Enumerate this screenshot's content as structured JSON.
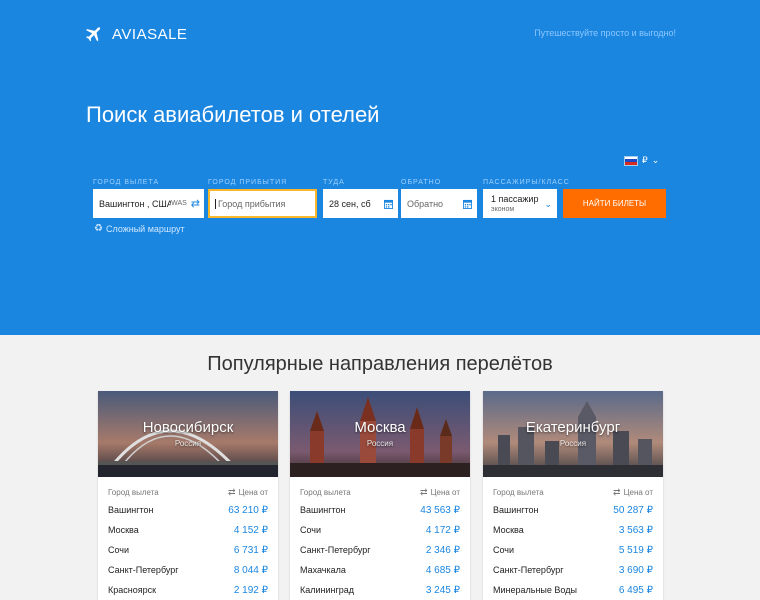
{
  "header": {
    "logo_text": "AVIASALE",
    "logo_icon": "airplane-icon",
    "slogan": "Путешествуйте просто и выгодно!"
  },
  "hero": {
    "title": "Поиск авиабилетов и отелей"
  },
  "currency": {
    "flag": "russia-flag-icon",
    "symbol": "₽"
  },
  "search": {
    "origin_label": "Город вылета",
    "origin_value": "Вашингтон , США",
    "origin_iata": "WAS",
    "destination_label": "Город прибытия",
    "destination_placeholder": "Город прибытия",
    "depart_label": "Туда",
    "depart_value": "28 сен, сб",
    "return_label": "Обратно",
    "return_placeholder": "Обратно",
    "passengers_label": "Пассажиры/класс",
    "passengers_value": "1 пассажир",
    "class_value": "эконом",
    "button_label": "НАЙТИ БИЛЕТЫ",
    "multi_route_label": "Сложный маршрут",
    "accent_color": "#1b86e0",
    "button_color": "#ff6d00"
  },
  "popular": {
    "title": "Популярные направления перелётов",
    "cards": [
      {
        "city": "Новосибирск",
        "country": "Россия",
        "col_from": "Город вылета",
        "col_price": "Цена от",
        "rows": [
          {
            "from": "Вашингтон",
            "price": "63 210 ₽"
          },
          {
            "from": "Москва",
            "price": "4 152 ₽"
          },
          {
            "from": "Сочи",
            "price": "6 731 ₽"
          },
          {
            "from": "Санкт-Петербург",
            "price": "8 044 ₽"
          },
          {
            "from": "Красноярск",
            "price": "2 192 ₽"
          }
        ]
      },
      {
        "city": "Москва",
        "country": "Россия",
        "col_from": "Город вылета",
        "col_price": "Цена от",
        "rows": [
          {
            "from": "Вашингтон",
            "price": "43 563 ₽"
          },
          {
            "from": "Сочи",
            "price": "4 172 ₽"
          },
          {
            "from": "Санкт-Петербург",
            "price": "2 346 ₽"
          },
          {
            "from": "Махачкала",
            "price": "4 685 ₽"
          },
          {
            "from": "Калининград",
            "price": "3 245 ₽"
          }
        ]
      },
      {
        "city": "Екатеринбург",
        "country": "Россия",
        "col_from": "Город вылета",
        "col_price": "Цена от",
        "rows": [
          {
            "from": "Вашингтон",
            "price": "50 287 ₽"
          },
          {
            "from": "Москва",
            "price": "3 563 ₽"
          },
          {
            "from": "Сочи",
            "price": "5 519 ₽"
          },
          {
            "from": "Санкт-Петербург",
            "price": "3 690 ₽"
          },
          {
            "from": "Минеральные Воды",
            "price": "6 495 ₽"
          }
        ]
      }
    ]
  }
}
